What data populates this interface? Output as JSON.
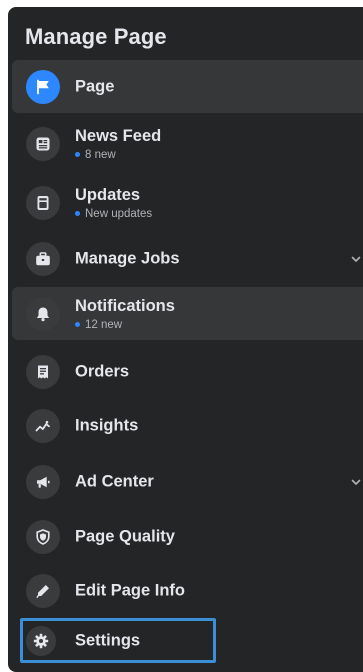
{
  "panel": {
    "title": "Manage Page"
  },
  "colors": {
    "background": "#242526",
    "highlight": "#353738",
    "accent": "#2d88ff",
    "text_primary": "#e4e6eb",
    "text_secondary": "#b0b3b8",
    "selection_border": "#3a8fd6"
  },
  "nav": {
    "page": {
      "label": "Page",
      "icon": "flag-icon",
      "state": "active"
    },
    "news_feed": {
      "label": "News Feed",
      "sub": "8 new",
      "icon": "news-feed-icon"
    },
    "updates": {
      "label": "Updates",
      "sub": "New updates",
      "icon": "updates-icon"
    },
    "manage_jobs": {
      "label": "Manage Jobs",
      "icon": "briefcase-icon",
      "expandable": true
    },
    "notifications": {
      "label": "Notifications",
      "sub": "12 new",
      "icon": "bell-icon",
      "state": "highlighted"
    },
    "orders": {
      "label": "Orders",
      "icon": "orders-icon"
    },
    "insights": {
      "label": "Insights",
      "icon": "insights-icon"
    },
    "ad_center": {
      "label": "Ad Center",
      "icon": "megaphone-icon",
      "expandable": true
    },
    "page_quality": {
      "label": "Page Quality",
      "icon": "shield-icon"
    },
    "edit_page_info": {
      "label": "Edit Page Info",
      "icon": "pencil-icon"
    },
    "settings": {
      "label": "Settings",
      "icon": "gear-icon",
      "state": "outlined"
    }
  }
}
